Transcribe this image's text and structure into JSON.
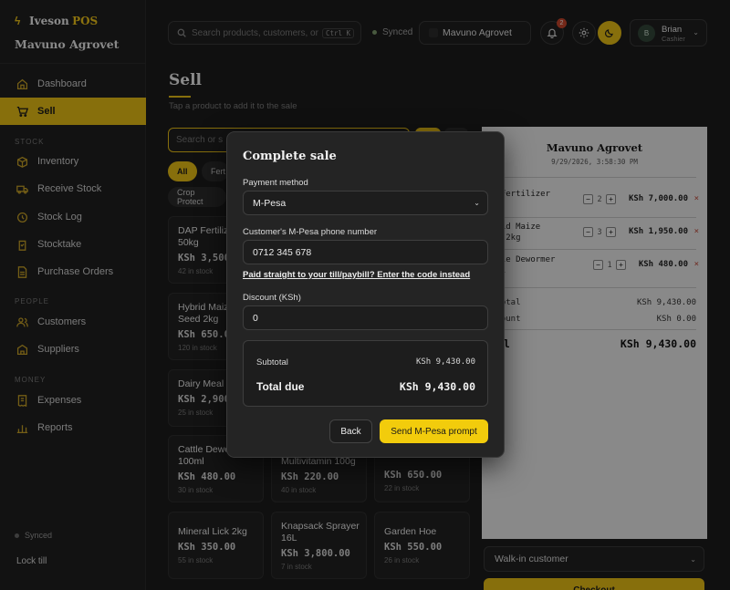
{
  "brand": {
    "name": "Iveson",
    "pos": "POS",
    "store": "Mavuno Agrovet"
  },
  "sidebar": {
    "items": [
      {
        "label": "Dashboard",
        "icon": "home-icon"
      },
      {
        "label": "Sell",
        "icon": "cart-icon"
      },
      {
        "label": "Inventory",
        "icon": "box-icon"
      },
      {
        "label": "Receive Stock",
        "icon": "truck-icon"
      },
      {
        "label": "Stock Log",
        "icon": "history-icon"
      },
      {
        "label": "Stocktake",
        "icon": "clipboard-icon"
      },
      {
        "label": "Purchase Orders",
        "icon": "document-icon"
      },
      {
        "label": "Customers",
        "icon": "users-icon"
      },
      {
        "label": "Suppliers",
        "icon": "building-icon"
      },
      {
        "label": "Expenses",
        "icon": "receipt-icon"
      },
      {
        "label": "Reports",
        "icon": "bar-chart-icon"
      }
    ],
    "sections": {
      "stock": "STOCK",
      "people": "PEOPLE",
      "money": "MONEY"
    },
    "synced": "Synced",
    "lock": "Lock till"
  },
  "topbar": {
    "search_placeholder": "Search products, customers, or",
    "shortcut": "Ctrl K",
    "synced": "Synced",
    "store": "Mavuno Agrovet",
    "notifications": "2",
    "user": {
      "initial": "B",
      "name": "Brian",
      "role": "Cashier"
    }
  },
  "main": {
    "title": "Sell",
    "subtitle": "Tap a product to add it to the sale",
    "search_placeholder": "Search or s",
    "chips": [
      "All",
      "Fert",
      "Crop Protect"
    ],
    "products": [
      {
        "name": "DAP Fertiliz",
        "name2": "50kg",
        "price": "KSh 3,500",
        "stock": "42 in stock"
      },
      {
        "name": "Hybrid Maiz",
        "name2": "Seed 2kg",
        "price": "KSh 650.0",
        "stock": "120 in stock"
      },
      {
        "name": "Dairy Meal 7",
        "name2": "",
        "price": "KSh 2,900",
        "stock": "25 in stock"
      },
      {
        "name": "Cattle Dewo",
        "name2": "100ml",
        "price": "KSh 480.00",
        "stock": "30 in stock"
      },
      {
        "name": "Multivitamin 100g",
        "name2": "",
        "price": "KSh 220.00",
        "stock": "40 in stock"
      },
      {
        "name": "",
        "name2": "",
        "price": "KSh 650.00",
        "stock": "22 in stock"
      },
      {
        "name": "Mineral Lick 2kg",
        "name2": "",
        "price": "KSh 350.00",
        "stock": "55 in stock"
      },
      {
        "name": "Knapsack Sprayer",
        "name2": "16L",
        "price": "KSh 3,800.00",
        "stock": "7 in stock"
      },
      {
        "name": "Garden Hoe",
        "name2": "",
        "price": "KSh 550.00",
        "stock": "26 in stock"
      }
    ]
  },
  "receipt": {
    "store": "Mavuno Agrovet",
    "date": "9/29/2026, 3:58:30 PM",
    "items": [
      {
        "name": "P Fertilizer",
        "name2": "kg",
        "qty": "2",
        "amount": "KSh 7,000.00"
      },
      {
        "name": "brid Maize",
        "name2": "ed 2kg",
        "qty": "3",
        "amount": "KSh 1,950.00"
      },
      {
        "name": "ttle Dewormer",
        "name2": "0ml",
        "qty": "1",
        "amount": "KSh 480.00"
      }
    ],
    "subtotal_label": "btotal",
    "subtotal": "KSh 9,430.00",
    "discount_label": "scount",
    "discount": "KSh 0.00",
    "total_label": "tal",
    "total": "KSh 9,430.00",
    "customer": "Walk-in customer",
    "checkout": "Checkout"
  },
  "modal": {
    "title": "Complete sale",
    "payment_label": "Payment method",
    "payment_value": "M-Pesa",
    "phone_label": "Customer's M-Pesa phone number",
    "phone_value": "0712 345 678",
    "paybill_link": "Paid straight to your till/paybill? Enter the code instead",
    "discount_label": "Discount (KSh)",
    "discount_value": "0",
    "subtotal_label": "Subtotal",
    "subtotal_value": "KSh 9,430.00",
    "total_label": "Total due",
    "total_value": "KSh 9,430.00",
    "back": "Back",
    "send": "Send M-Pesa prompt"
  },
  "colors": {
    "accent": "#e9bf16",
    "background": "#1c1c1c",
    "danger": "#c04a3a"
  }
}
